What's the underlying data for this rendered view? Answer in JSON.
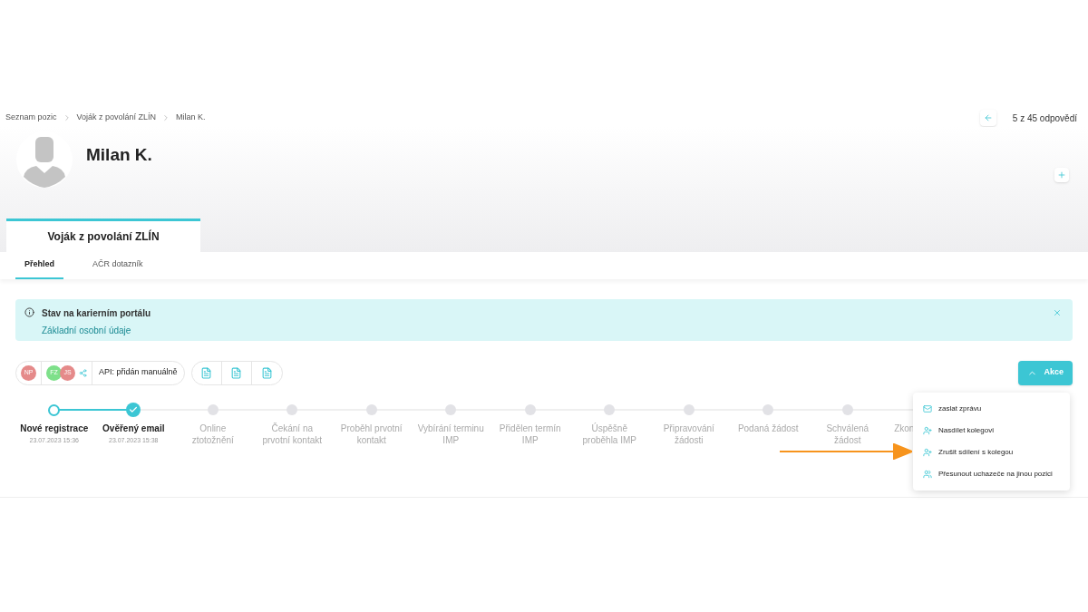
{
  "breadcrumb": [
    "Seznam pozic",
    "Voják z povolání ZLÍN",
    "Milan K."
  ],
  "pager": {
    "text": "5 z 45 odpovědí"
  },
  "candidate": {
    "name": "Milan K."
  },
  "position_tab": {
    "label": "Voják z povolání ZLÍN"
  },
  "tabs": [
    {
      "label": "Přehled",
      "selected": true
    },
    {
      "label": "AČR dotazník",
      "selected": false
    }
  ],
  "alert": {
    "title": "Stav na karierním portálu",
    "text": "Základní osobní údaje"
  },
  "avatars": [
    {
      "initials": "NP",
      "color": "#e58a8a"
    },
    {
      "initials": "FZ",
      "color": "#7ee08a"
    },
    {
      "initials": "JS",
      "color": "#e58a8a"
    }
  ],
  "source": "API: přidán manuálně",
  "actions_button": {
    "label": "Akce",
    "expanded": true
  },
  "steps": [
    {
      "label": "Nové registrace",
      "date": "23.07.2023 15:36",
      "kind": "current"
    },
    {
      "label": "Ověřený email",
      "date": "23.07.2023 15:38",
      "kind": "done"
    },
    {
      "label": "Online ztotožnění",
      "kind": "pending"
    },
    {
      "label": "Čekání na prvotní kontakt",
      "kind": "pending"
    },
    {
      "label": "Proběhl prvotní kontakt",
      "kind": "pending"
    },
    {
      "label": "Vybírání terminu IMP",
      "kind": "pending"
    },
    {
      "label": "Přidělen termín IMP",
      "kind": "pending"
    },
    {
      "label": "Úspěšně proběhla IMP",
      "kind": "pending"
    },
    {
      "label": "Připravování žádosti",
      "kind": "pending"
    },
    {
      "label": "Podaná žádost",
      "kind": "pending"
    },
    {
      "label": "Schválená žádost",
      "kind": "pending"
    },
    {
      "label": "Zkon",
      "kind": "pending"
    }
  ],
  "menu": [
    {
      "label": "zaslat zprávu",
      "kind": "mail"
    },
    {
      "label": "Nasdílet kolegovi",
      "kind": "user-add"
    },
    {
      "label": "Zrušit sdílení s kolegou",
      "kind": "user-add"
    },
    {
      "label": "Přesunout uchazeče na jinou pozici",
      "kind": "users"
    }
  ]
}
